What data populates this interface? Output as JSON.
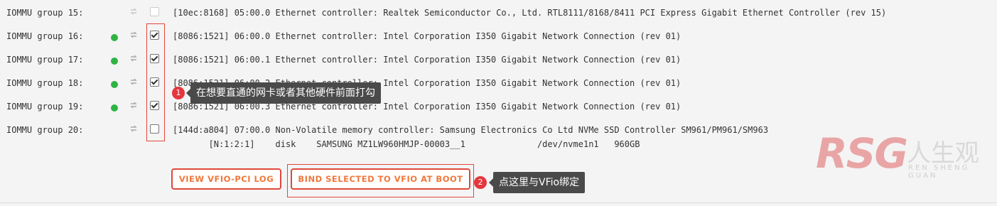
{
  "rows": [
    {
      "group": "IOMMU group 15:",
      "active": false,
      "checked": false,
      "disabled": true,
      "desc": "[10ec:8168] 05:00.0 Ethernet controller: Realtek Semiconductor Co., Ltd. RTL8111/8168/8411 PCI Express Gigabit Ethernet Controller (rev 15)"
    },
    {
      "group": "IOMMU group 16:",
      "active": true,
      "checked": true,
      "disabled": false,
      "desc": "[8086:1521] 06:00.0 Ethernet controller: Intel Corporation I350 Gigabit Network Connection (rev 01)"
    },
    {
      "group": "IOMMU group 17:",
      "active": true,
      "checked": true,
      "disabled": false,
      "desc": "[8086:1521] 06:00.1 Ethernet controller: Intel Corporation I350 Gigabit Network Connection (rev 01)"
    },
    {
      "group": "IOMMU group 18:",
      "active": true,
      "checked": true,
      "disabled": false,
      "desc": "[8086:1521] 06:00.2 Ethernet controller: Intel Corporation I350 Gigabit Network Connection (rev 01)"
    },
    {
      "group": "IOMMU group 19:",
      "active": true,
      "checked": true,
      "disabled": false,
      "desc": "[8086:1521] 06:00.3 Ethernet controller: Intel Corporation I350 Gigabit Network Connection (rev 01)"
    },
    {
      "group": "IOMMU group 20:",
      "active": false,
      "checked": false,
      "disabled": false,
      "desc": "[144d:a804] 07:00.0 Non-Volatile memory controller: Samsung Electronics Co Ltd NVMe SSD Controller SM961/PM961/SM963"
    }
  ],
  "nvme_detail": "       [N:1:2:1]    disk    SAMSUNG MZ1LW960HMJP-00003__1              /dev/nvme1n1   960GB",
  "buttons": {
    "view_log": "VIEW VFIO-PCI LOG",
    "bind": "BIND SELECTED TO VFIO AT BOOT"
  },
  "annotations": {
    "badge1": "1",
    "callout1": "在想要直通的网卡或者其他硬件前面打勾",
    "badge2": "2",
    "callout2": "点这里与VFio绑定"
  },
  "watermark": {
    "brand": "RSG",
    "cn": "人生观",
    "en": "REN SHENG GUAN"
  },
  "colors": {
    "accent": "#e0483a",
    "button_text": "#f0783c",
    "active_dot": "#2fb344",
    "callout_bg": "#4a4a4a"
  }
}
